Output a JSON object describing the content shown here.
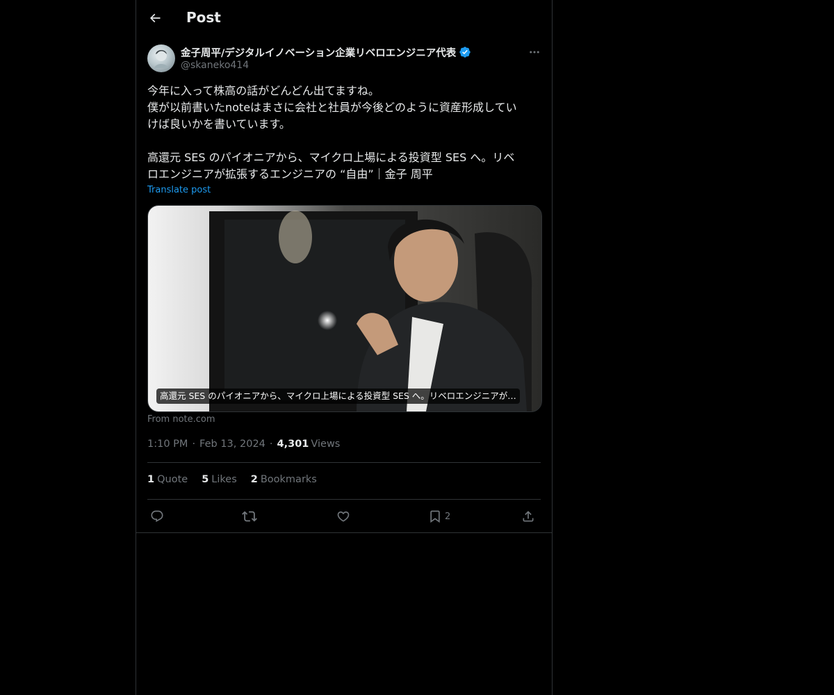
{
  "header": {
    "title": "Post",
    "back_icon": "arrow-left-icon"
  },
  "author": {
    "display_name": "金子周平/デジタルイノベーション企業リベロエンジニア代表",
    "handle": "@skaneko414",
    "verified_icon": "verified-badge-icon",
    "verified_color": "#1d9bf0"
  },
  "post": {
    "text": "今年に入って株高の話がどんどん出てますね。\n僕が以前書いたnoteはまさに会社と社員が今後どのように資産形成してい\nけば良いかを書いています。\n\n高還元 SES のパイオニアから、マイクロ上場による投資型 SES へ。リベ\nロエンジニアが拡張するエンジニアの “自由”｜金子 周平",
    "translate_label": "Translate post"
  },
  "link_card": {
    "caption": "高還元 SES のパイオニアから、マイクロ上場による投資型 SES へ。リベロエンジニアが…",
    "source": "From note.com"
  },
  "meta": {
    "time": "1:10 PM",
    "date": "Feb 13, 2024",
    "separator": "·",
    "views_count": "4,301",
    "views_label": "Views"
  },
  "stats": [
    {
      "count": "1",
      "label": "Quote"
    },
    {
      "count": "5",
      "label": "Likes"
    },
    {
      "count": "2",
      "label": "Bookmarks"
    }
  ],
  "actions": {
    "reply_icon": "reply-icon",
    "repost_icon": "repost-icon",
    "like_icon": "heart-icon",
    "bookmark_icon": "bookmark-icon",
    "bookmark_count": "2",
    "share_icon": "share-icon"
  },
  "colors": {
    "background": "#000000",
    "text": "#e7e9ea",
    "secondary": "#71767b",
    "accent": "#1d9bf0",
    "border": "#2f3336"
  }
}
